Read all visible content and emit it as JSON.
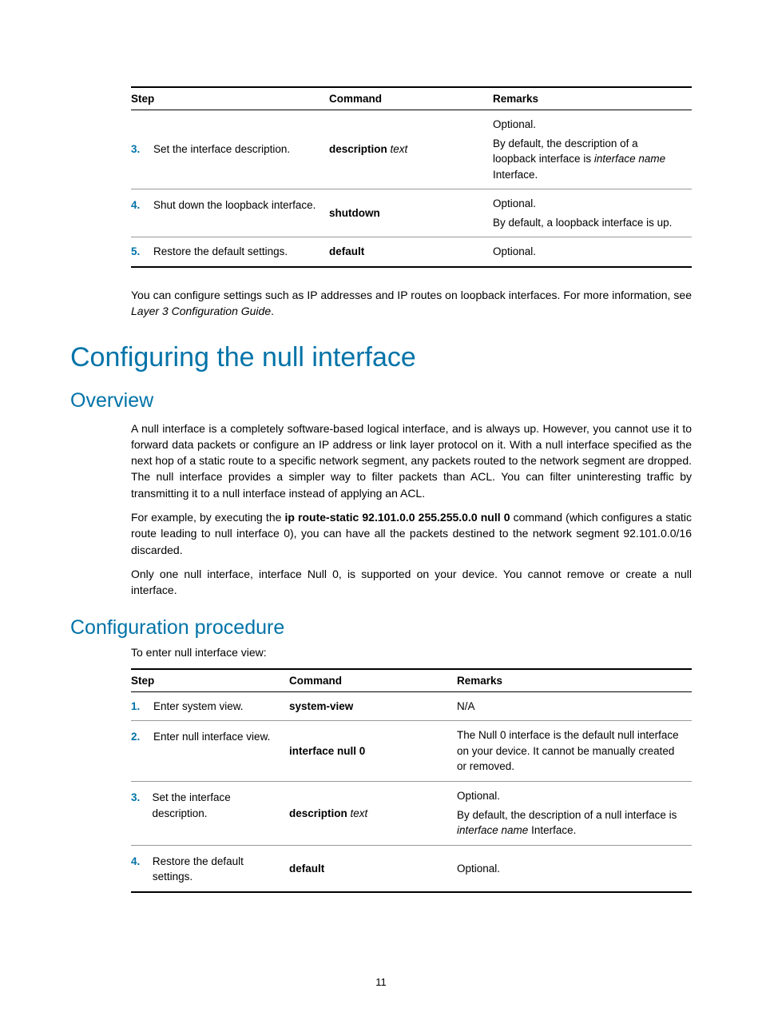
{
  "table1": {
    "headers": {
      "step": "Step",
      "command": "Command",
      "remarks": "Remarks"
    },
    "rows": [
      {
        "num": "3.",
        "desc": "Set the interface description.",
        "cmd_bold": "description",
        "cmd_italic": " text",
        "remarks_line1": "Optional.",
        "remarks_line2a": "By default, the description of a loopback interface is ",
        "remarks_line2b": "interface name",
        "remarks_line2c": " Interface."
      },
      {
        "num": "4.",
        "desc": "Shut down the loopback interface.",
        "cmd_bold": "shutdown",
        "remarks_line1": "Optional.",
        "remarks_line2": "By default, a loopback interface is up."
      },
      {
        "num": "5.",
        "desc": "Restore the default settings.",
        "cmd_bold": "default",
        "remarks_line1": "Optional."
      }
    ]
  },
  "para1a": "You can configure settings such as IP addresses and IP routes on loopback interfaces. For more information, see ",
  "para1b": "Layer 3 Configuration Guide",
  "para1c": ".",
  "h1": "Configuring the null interface",
  "h2a": "Overview",
  "para2": "A null interface is a completely software-based logical interface, and is always up. However, you cannot use it to forward data packets or configure an IP address or link layer protocol on it. With a null interface specified as the next hop of a static route to a specific network segment, any packets routed to the network segment are dropped. The null interface provides a simpler way to filter packets than ACL. You can filter uninteresting traffic by transmitting it to a null interface instead of applying an ACL.",
  "para3a": "For example, by executing the ",
  "para3b": "ip route-static 92.101.0.0 255.255.0.0 null 0",
  "para3c": " command (which configures a static route leading to null interface 0), you can have all the packets destined to the network segment 92.101.0.0/16 discarded.",
  "para4": "Only one null interface, interface Null 0, is supported on your device. You cannot remove or create a null interface.",
  "h2b": "Configuration procedure",
  "para5": "To enter null interface view:",
  "table2": {
    "headers": {
      "step": "Step",
      "command": "Command",
      "remarks": "Remarks"
    },
    "rows": [
      {
        "num": "1.",
        "desc": "Enter system view.",
        "cmd_bold": "system-view",
        "remarks": "N/A"
      },
      {
        "num": "2.",
        "desc": "Enter null interface view.",
        "cmd_bold": "interface null 0",
        "remarks": "The Null 0 interface is the default null interface on your device. It cannot be manually created or removed."
      },
      {
        "num": "3.",
        "desc": "Set the interface description.",
        "cmd_bold": "description",
        "cmd_italic": " text",
        "remarks_line1": "Optional.",
        "remarks_line2a": "By default, the description of a null interface is ",
        "remarks_line2b": "interface name",
        "remarks_line2c": " Interface."
      },
      {
        "num": "4.",
        "desc": "Restore the default settings.",
        "cmd_bold": "default",
        "remarks": "Optional."
      }
    ]
  },
  "page_number": "11"
}
